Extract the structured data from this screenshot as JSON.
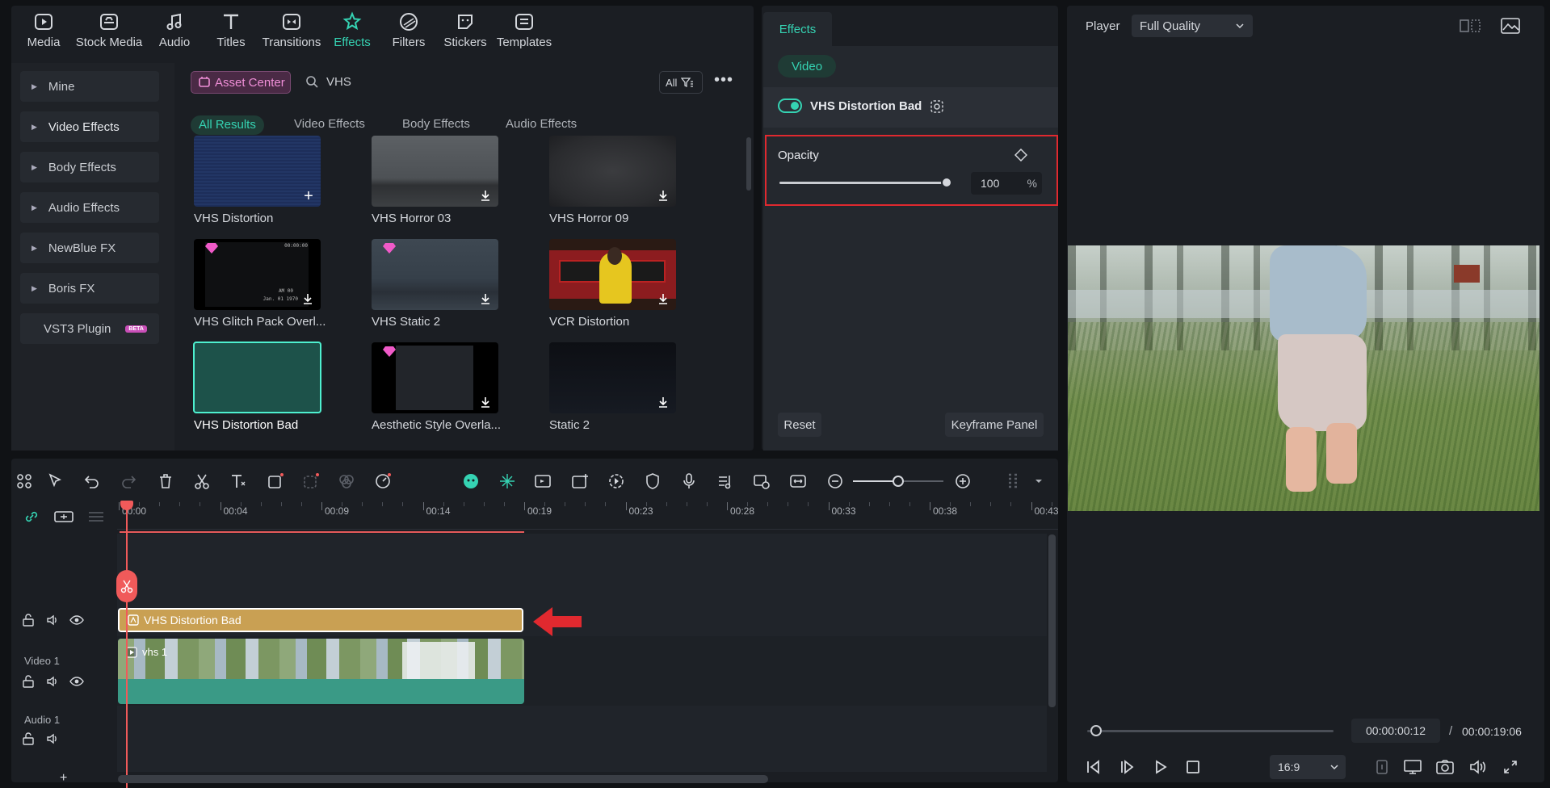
{
  "toolbar": {
    "items": [
      {
        "label": "Media",
        "icon": "media-icon"
      },
      {
        "label": "Stock Media",
        "icon": "stock-media-icon"
      },
      {
        "label": "Audio",
        "icon": "audio-icon"
      },
      {
        "label": "Titles",
        "icon": "titles-icon"
      },
      {
        "label": "Transitions",
        "icon": "transitions-icon"
      },
      {
        "label": "Effects",
        "icon": "effects-icon"
      },
      {
        "label": "Filters",
        "icon": "filters-icon"
      },
      {
        "label": "Stickers",
        "icon": "stickers-icon"
      },
      {
        "label": "Templates",
        "icon": "templates-icon"
      }
    ],
    "active": "Effects"
  },
  "sidebar": {
    "items": [
      {
        "label": "Mine"
      },
      {
        "label": "Video Effects"
      },
      {
        "label": "Body Effects"
      },
      {
        "label": "Audio Effects"
      },
      {
        "label": "NewBlue FX"
      },
      {
        "label": "Boris FX"
      },
      {
        "label": "VST3 Plugin",
        "badge": "BETA"
      }
    ]
  },
  "library": {
    "asset_center_label": "Asset Center",
    "search_value": "VHS",
    "filter_label": "All",
    "tabs": [
      "All Results",
      "Video Effects",
      "Body Effects",
      "Audio Effects"
    ],
    "active_tab": "All Results",
    "thumbnails": [
      {
        "label": "VHS Distortion"
      },
      {
        "label": "VHS Horror 03"
      },
      {
        "label": "VHS Horror 09"
      },
      {
        "label": "VHS Glitch Pack Overl..."
      },
      {
        "label": "VHS Static 2"
      },
      {
        "label": "VCR Distortion"
      },
      {
        "label": "VHS Distortion Bad"
      },
      {
        "label": "Aesthetic Style Overla..."
      },
      {
        "label": "Static 2"
      }
    ],
    "overlay_texts": {
      "glitch_date": "Jan. 01 1970",
      "glitch_time": "AM 00",
      "glitch_counter": "00:00:00"
    }
  },
  "effects_panel": {
    "tab": "Effects",
    "subtab": "Video",
    "effect_name": "VHS Distortion Bad",
    "opacity_label": "Opacity",
    "opacity_value": "100",
    "opacity_unit": "%",
    "opacity_fraction": 1.0,
    "reset_label": "Reset",
    "keyframe_label": "Keyframe Panel"
  },
  "player": {
    "label": "Player",
    "quality": "Full Quality",
    "current_time": "00:00:00:12",
    "separator": "/",
    "total_time": "00:00:19:06",
    "aspect": "16:9"
  },
  "timeline": {
    "ruler": [
      "00:00",
      "00:04",
      "00:09",
      "00:14",
      "00:19",
      "00:23",
      "00:28",
      "00:33",
      "00:38",
      "00:43"
    ],
    "tracks": [
      {
        "label": ""
      },
      {
        "label": "Video 1"
      },
      {
        "label": "Audio 1"
      }
    ],
    "effect_clip": "VHS Distortion Bad",
    "video_clip": "vhs 1",
    "add_track": "+"
  },
  "colors": {
    "accent": "#35d3b3",
    "highlight": "#e0292f",
    "clip_gold": "#c9a053",
    "clip_teal": "#3a9a86",
    "playhead": "#f05a5a"
  }
}
